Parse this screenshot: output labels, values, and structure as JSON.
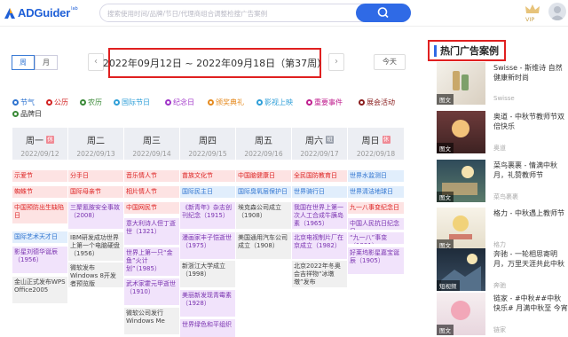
{
  "header": {
    "logo_text": "ADGuider",
    "logo_sup": "lab",
    "search_placeholder": "搜索使用时间/品牌/节日/代理商组合调整检搜广告案例",
    "vip_label": "VIP"
  },
  "toolbar": {
    "week_label": "周",
    "month_label": "月",
    "prev_arrow": "‹",
    "next_arrow": "›",
    "date_range": "2022年09月12日 ~ 2022年09月18日（第37周）",
    "today_label": "今天"
  },
  "legend": [
    {
      "label": "节气",
      "color": "#2f74d0"
    },
    {
      "label": "公历",
      "color": "#d22222"
    },
    {
      "label": "农历",
      "color": "#3b8a38"
    },
    {
      "label": "国际节日",
      "color": "#2f9fd8"
    },
    {
      "label": "纪念日",
      "color": "#a035c8"
    },
    {
      "label": "颁奖典礼",
      "color": "#e58a1f"
    },
    {
      "label": "影视上映",
      "color": "#2f9fd8"
    },
    {
      "label": "重要事件",
      "color": "#c0208f"
    },
    {
      "label": "展会活动",
      "color": "#8a1d1d"
    },
    {
      "label": "品牌日",
      "color": "#3b8a38"
    }
  ],
  "days": [
    {
      "name": "周一",
      "date": "2022/09/12",
      "badge": "休"
    },
    {
      "name": "周二",
      "date": "2022/09/13",
      "badge": ""
    },
    {
      "name": "周三",
      "date": "2022/09/14",
      "badge": ""
    },
    {
      "name": "周四",
      "date": "2022/09/15",
      "badge": ""
    },
    {
      "name": "周五",
      "date": "2022/09/16",
      "badge": ""
    },
    {
      "name": "周六",
      "date": "2022/09/17",
      "badge": "班"
    },
    {
      "name": "周日",
      "date": "2022/09/18",
      "badge": "休"
    }
  ],
  "events": {
    "mon": [
      "示爱节",
      "蜘蛛节",
      "中国预防出生缺陷日",
      "国际艺术天才日",
      "影星刘德华诞辰（1956）",
      "金山正式发布WPS Office2005"
    ],
    "tue": [
      "分手日",
      "国际母亲节",
      "三聚氰胺安全事故（2008）",
      "IBM研发成功世界上第一个电脑硬盘（1956）",
      "微软发布Windows 8开发者预览版"
    ],
    "wed": [
      "音乐情人节",
      "相片情人节",
      "中国网民节",
      "意大利诗人但丁逝世（1321）",
      "世界上第一只“金鱼”火计划”（1985）",
      "武术家霍元甲逝世（1910）",
      "微软公司发行Windows Me"
    ],
    "thu": [
      "苗族文化节",
      "国际民主日",
      "《新青年》杂志创刊纪念（1915）",
      "漫画家丰子恺逝世（1975）",
      "新浙江大学成立（1998）",
      "美丽新发现青霉素（1928）",
      "世界绿色和平组织"
    ],
    "fri": [
      "中国脑健康日",
      "国际臭氧层保护日",
      "埃克森公司成立（1908）",
      "美国通用汽车公司成立（1908）"
    ],
    "sat": [
      "全民国防教育日",
      "世界骑行日",
      "我国在世界上第一次人工合成牛胰岛素（1965）",
      "北京电视制片厂在京成立（1982）",
      "北京2022年冬奥会吉祥物“冰墩墩”发布"
    ],
    "sun": [
      "世界水监测日",
      "世界清洁地球日",
      "九一八事变纪念日",
      "中国人民抗日纪念日",
      "“九一八”事变（1931）",
      "好莱坞影星嘉宝诞辰（1905）"
    ]
  },
  "sidebar": {
    "title": "热门广告案例",
    "cards": [
      {
        "title": "Swisse - 斯维诗 自然健康新时尚",
        "brand": "Swisse",
        "tag": "图文"
      },
      {
        "title": "奥道 - 中秋节教师节双倍快乐",
        "brand": "奥道",
        "tag": "图文"
      },
      {
        "title": "菜鸟裹裹 - 情满中秋月，礼赞教师节",
        "brand": "菜鸟裹裹",
        "tag": "图文"
      },
      {
        "title": "格力 - 中秋遇上教师节",
        "brand": "格力",
        "tag": "图文"
      },
      {
        "title": "奔驰 - 一轮相思寄明月，万里天涯共此中秋",
        "brand": "奔驰",
        "tag": "短视频"
      },
      {
        "title": "链家 - #中秋##中秋快乐# 月满中秋至 今宵",
        "brand": "链家",
        "tag": "图文"
      }
    ]
  },
  "colors": {
    "brand_blue": "#2f6ae6",
    "highlight_red": "#e02020"
  }
}
